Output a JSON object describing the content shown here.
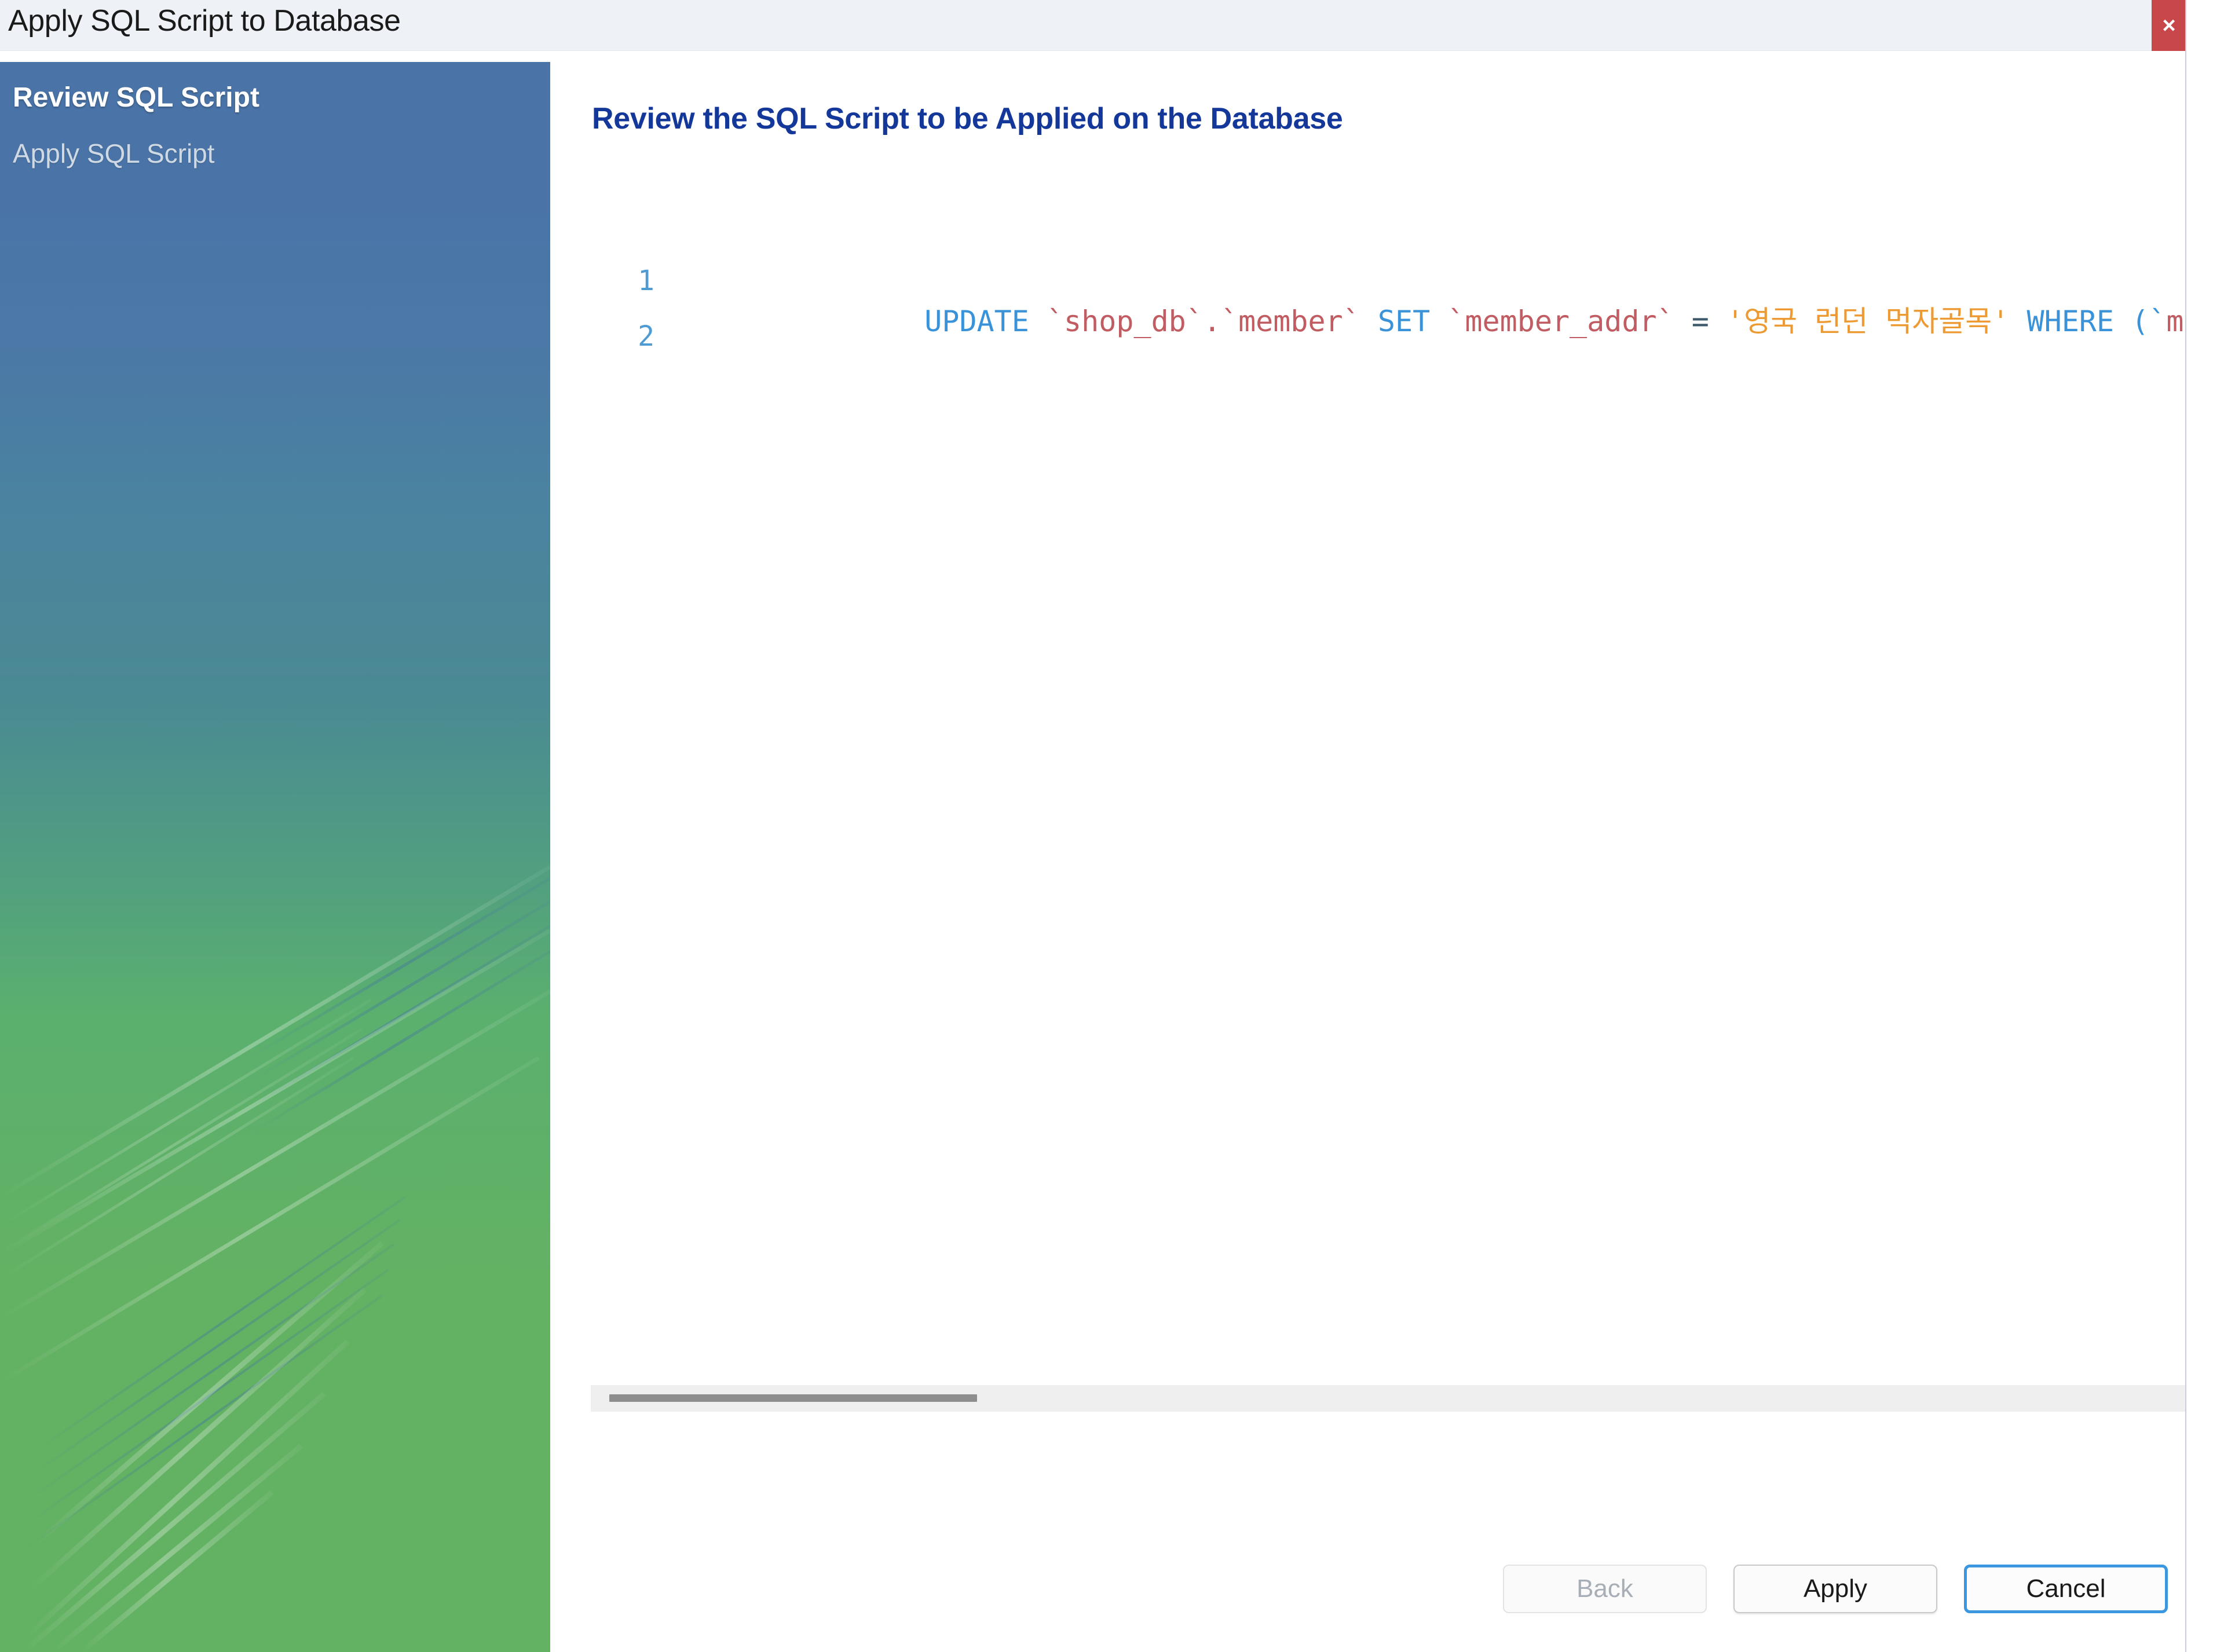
{
  "window": {
    "title": "Apply SQL Script to Database",
    "close_label": "×",
    "close_icon": "close-icon"
  },
  "sidebar": {
    "items": [
      {
        "label": "Review SQL Script",
        "state": "active"
      },
      {
        "label": "Apply SQL Script",
        "state": "pending"
      }
    ],
    "colors": {
      "top": "#4a74a8",
      "middle": "#4a8a93",
      "bottom": "#63b163"
    }
  },
  "main": {
    "heading": "Review the SQL Script to be Applied on the Database",
    "heading_color": "#14379a"
  },
  "editor": {
    "lines": [
      {
        "number": "1",
        "tokens": [
          {
            "text": "UPDATE ",
            "type": "keyword"
          },
          {
            "text": "`shop_db`.`member` ",
            "type": "identifier"
          },
          {
            "text": "SET ",
            "type": "keyword"
          },
          {
            "text": "`member_addr` ",
            "type": "identifier"
          },
          {
            "text": "= ",
            "type": "operator"
          },
          {
            "text": "'영국 런던 먹자골목' ",
            "type": "string"
          },
          {
            "text": "WHERE ",
            "type": "keyword"
          },
          {
            "text": "(`",
            "type": "punctuation"
          },
          {
            "text": "m",
            "type": "identifier"
          }
        ]
      },
      {
        "number": "2",
        "tokens": []
      }
    ],
    "token_colors": {
      "keyword": "#3a93d8",
      "identifier": "#c05c62",
      "string": "#ee9a33",
      "operator": "#3d5a6c",
      "punctuation": "#3a93d8",
      "line_number": "#4f9bd4"
    },
    "scrollbar": {
      "orientation": "horizontal",
      "thumb_position_percent": 1,
      "thumb_width_percent": 23
    }
  },
  "footer": {
    "buttons": [
      {
        "label": "Back",
        "state": "disabled"
      },
      {
        "label": "Apply",
        "state": "enabled"
      },
      {
        "label": "Cancel",
        "state": "focused"
      }
    ],
    "focus_color": "#3b97e0"
  }
}
